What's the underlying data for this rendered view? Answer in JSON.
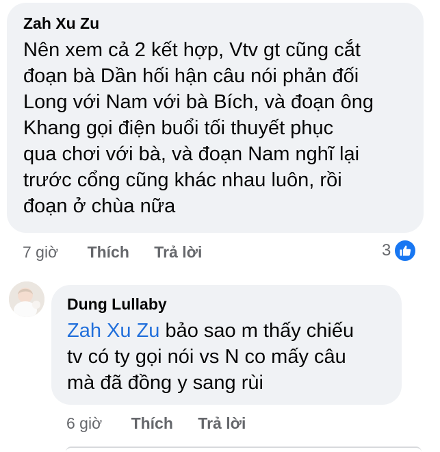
{
  "comments": [
    {
      "author": "Zah Xu Zu",
      "lines": [
        "Nên xem cả 2 kết hợp, Vtv gt cũng cắt",
        "đoạn bà Dần hối hận câu nói phản đối",
        "Long với Nam với bà Bích, và đoạn ông",
        "Khang gọi điện buổi tối thuyết phục",
        "qua chơi với bà, và đoạn Nam nghĩ lại",
        "trước cổng cũng khác nhau luôn, rồi",
        "đoạn ở chùa nữa"
      ],
      "time": "7 giờ",
      "like_label": "Thích",
      "reply_label": "Trả lời",
      "reaction_count": "3",
      "reaction_icon": "like-icon"
    },
    {
      "author": "Dung Lullaby",
      "mention": "Zah Xu Zu",
      "line1_rest": " bảo sao m thấy chiếu",
      "lines": [
        "tv có ty gọi nói vs N co mấy câu",
        "mà đã đồng y sang rùi"
      ],
      "time": "6 giờ",
      "like_label": "Thích",
      "reply_label": "Trả lời"
    }
  ],
  "colors": {
    "bubble": "#f0f2f5",
    "mention": "#216fdb",
    "meta": "#65676b",
    "like_blue": "#1877f2"
  }
}
